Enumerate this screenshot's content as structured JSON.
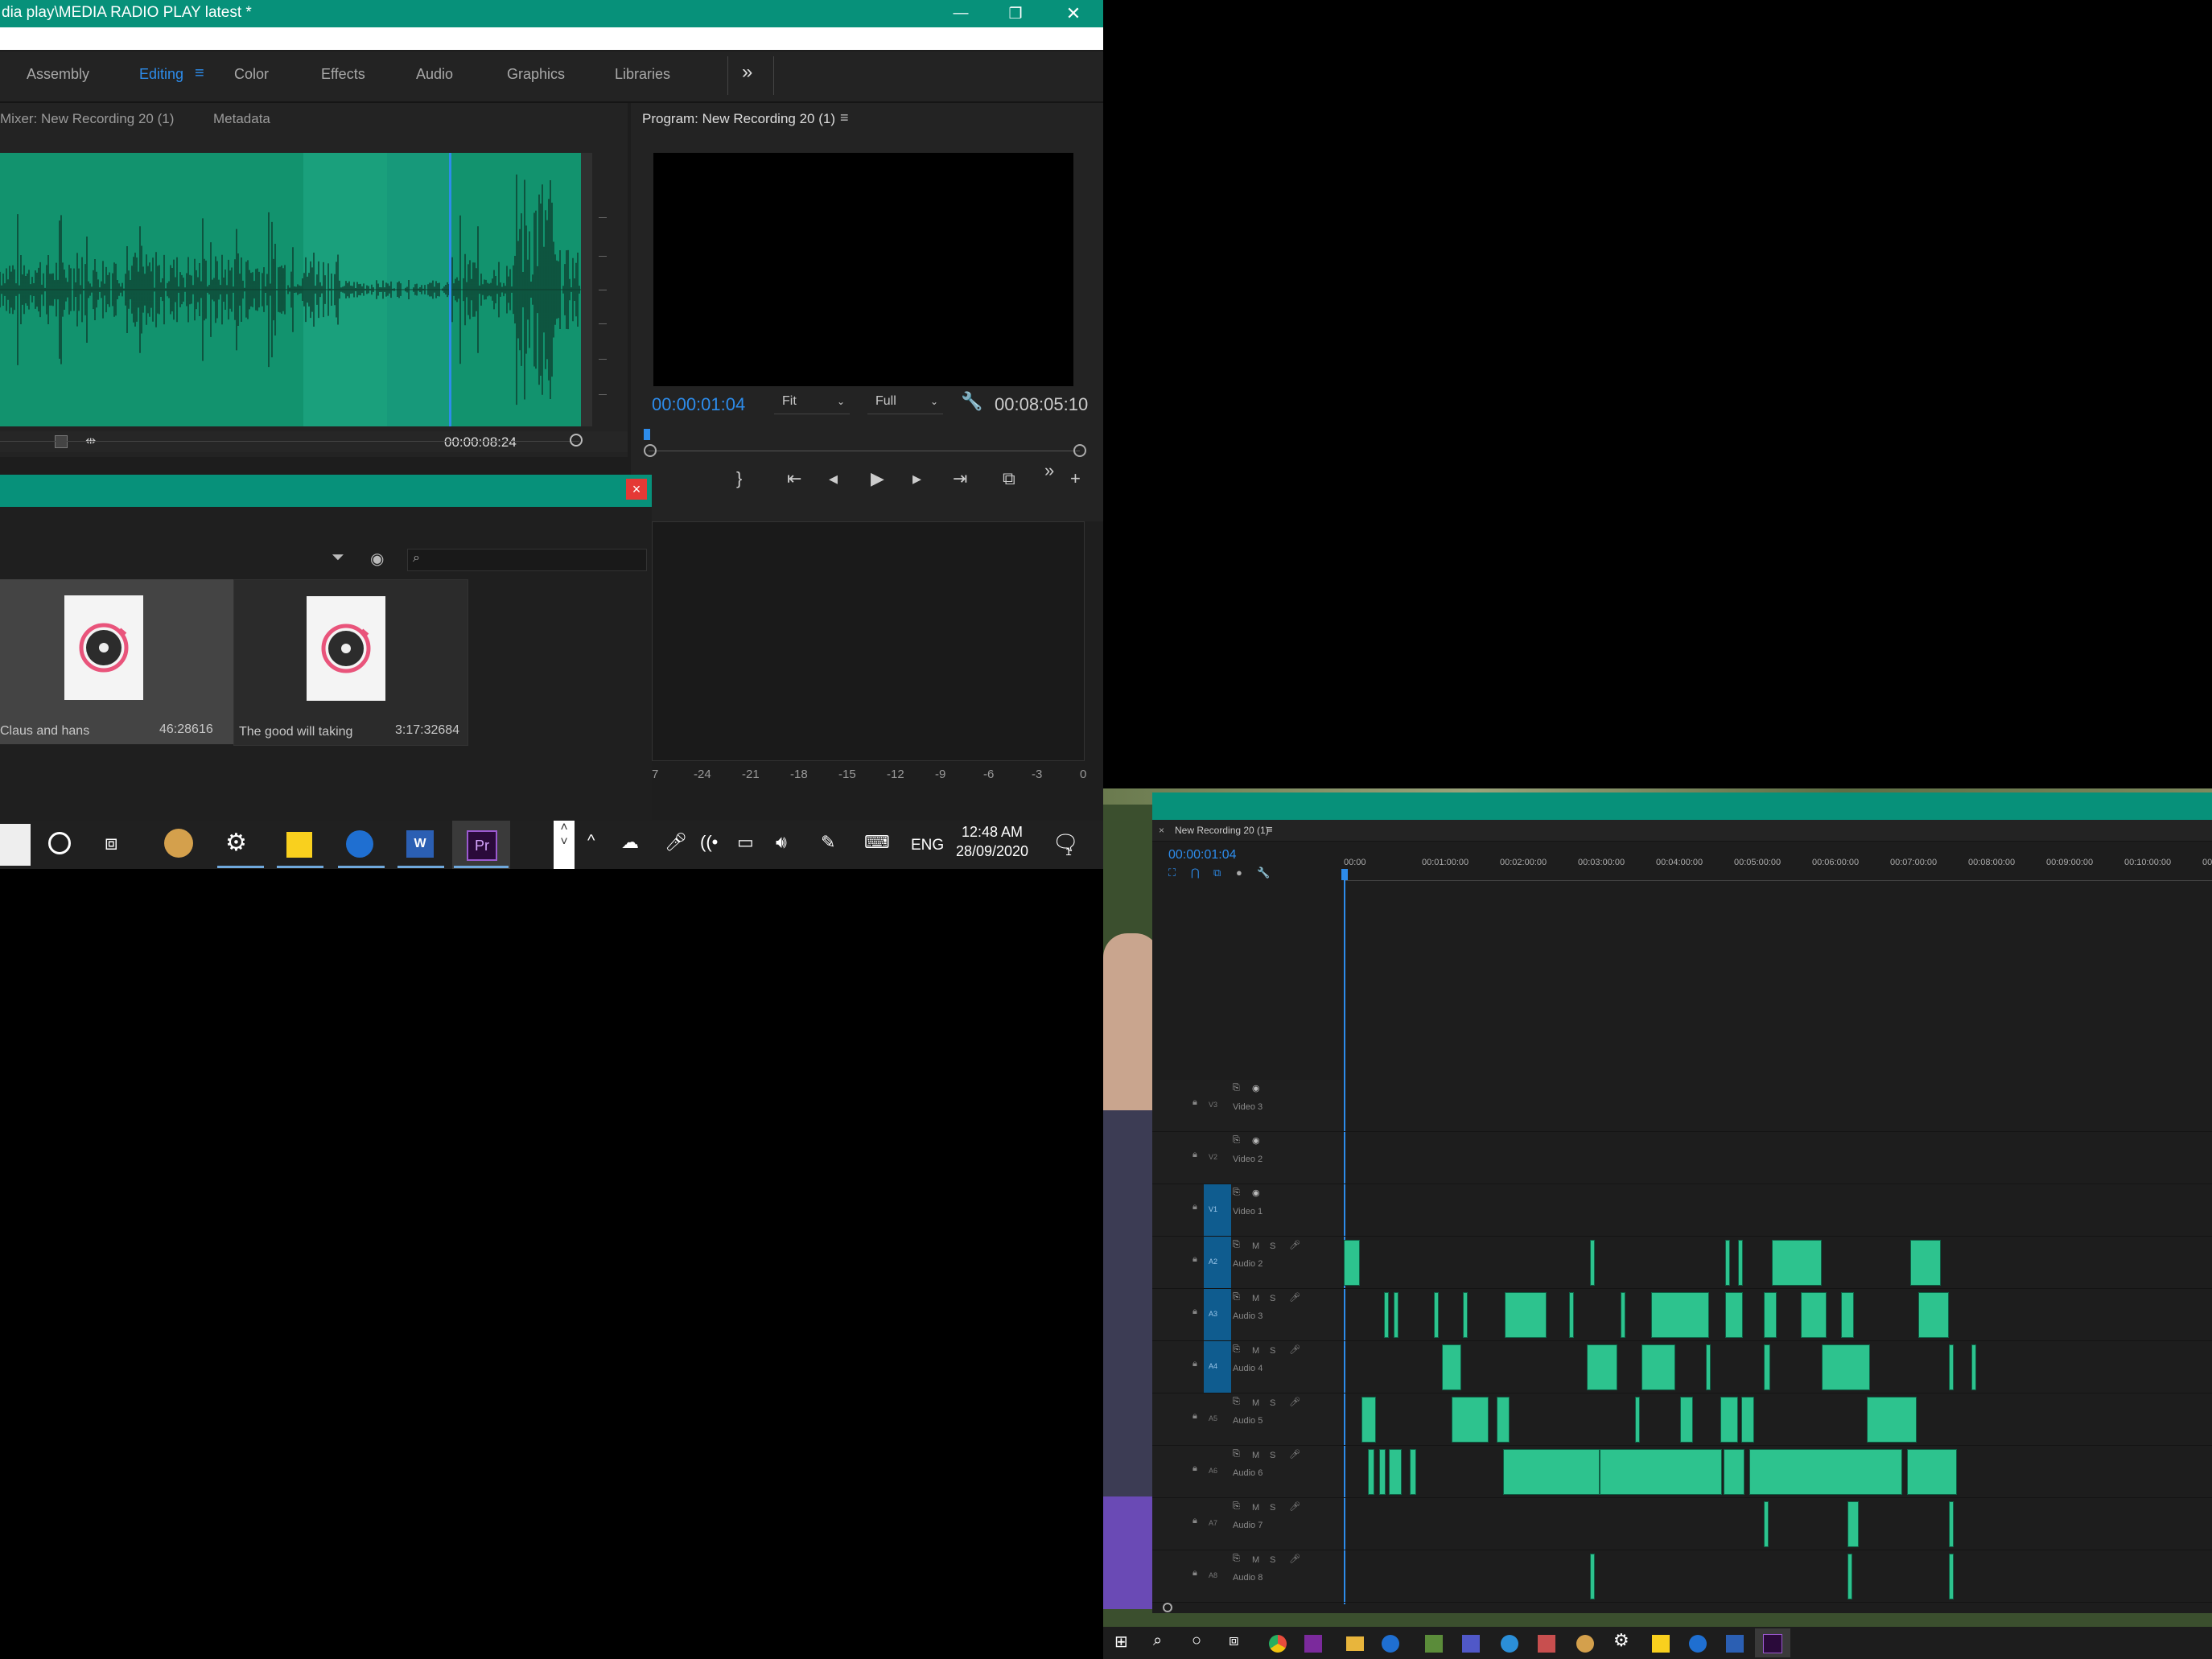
{
  "window": {
    "title": "dia play\\MEDIA RADIO PLAY latest *",
    "minimize": "—",
    "maximize": "❐",
    "close": "✕"
  },
  "workspaces": [
    "Assembly",
    "Editing",
    "Color",
    "Effects",
    "Audio",
    "Graphics",
    "Libraries"
  ],
  "workspace_active": "Editing",
  "overflow": "»",
  "source_panel": {
    "tab_mixer": "Mixer: New Recording 20 (1)",
    "tab_metadata": "Metadata",
    "timecode": "00:00:08:24"
  },
  "program_panel": {
    "title": "Program: New Recording 20 (1)",
    "timecode": "00:00:01:04",
    "fit": "Fit",
    "full": "Full",
    "duration": "00:08:05:10"
  },
  "project": {
    "close": "×",
    "items": [
      {
        "name": "Claus and hans",
        "duration": "46:28616"
      },
      {
        "name": "The good will taking",
        "duration": "3:17:32684"
      }
    ]
  },
  "meter_labels": [
    "7",
    "-24",
    "-21",
    "-18",
    "-15",
    "-12",
    "-9",
    "-6",
    "-3",
    "0"
  ],
  "taskbar": {
    "lang": "ENG",
    "time": "12:48 AM",
    "date": "28/09/2020",
    "notifications": "1"
  },
  "timeline": {
    "title": "New Recording 20 (1)",
    "timecode": "00:00:01:04",
    "ruler": [
      "00:00",
      "00:01:00:00",
      "00:02:00:00",
      "00:03:00:00",
      "00:04:00:00",
      "00:05:00:00",
      "00:06:00:00",
      "00:07:00:00",
      "00:08:00:00",
      "00:09:00:00",
      "00:10:00:00",
      "00:11:0"
    ],
    "video_tracks": [
      {
        "id": "V3",
        "name": "Video 3"
      },
      {
        "id": "V2",
        "name": "Video 2"
      },
      {
        "id": "V1",
        "name": "Video 1"
      }
    ],
    "audio_tracks": [
      {
        "id": "A2",
        "name": "Audio 2"
      },
      {
        "id": "A3",
        "name": "Audio 3"
      },
      {
        "id": "A4",
        "name": "Audio 4"
      },
      {
        "id": "A5",
        "name": "Audio 5"
      },
      {
        "id": "A6",
        "name": "Audio 6"
      },
      {
        "id": "A7",
        "name": "Audio 7"
      },
      {
        "id": "A8",
        "name": "Audio 8"
      }
    ],
    "track_buttons": {
      "mute": "M",
      "solo": "S"
    }
  },
  "colors": {
    "teal": "#07917a",
    "waveform": "#12936e",
    "accent_blue": "#2d8ceb",
    "clip_green": "#2dc38e"
  }
}
